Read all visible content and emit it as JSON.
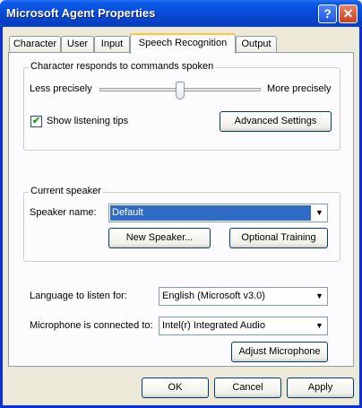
{
  "window": {
    "title": "Microsoft Agent Properties"
  },
  "titlebar_buttons": {
    "help": "?",
    "close": "✕"
  },
  "tabs": [
    {
      "label": "Character"
    },
    {
      "label": "User"
    },
    {
      "label": "Input"
    },
    {
      "label": "Speech Recognition",
      "active": true
    },
    {
      "label": "Output"
    }
  ],
  "commands_group": {
    "title": "Character responds to commands spoken",
    "less_label": "Less precisely",
    "more_label": "More precisely",
    "precision_level": 0.5,
    "show_tips_label": "Show listening tips",
    "show_tips_checked": true,
    "advanced_button": "Advanced Settings"
  },
  "speaker_group": {
    "title": "Current speaker",
    "speaker_label": "Speaker name:",
    "speaker_value": "Default",
    "new_speaker_button": "New Speaker...",
    "optional_training_button": "Optional Training"
  },
  "language": {
    "label": "Language to listen for:",
    "value": "English (Microsoft v3.0)"
  },
  "microphone": {
    "label": "Microphone is connected to:",
    "value": "Intel(r) Integrated Audio"
  },
  "adjust_microphone_button": "Adjust Microphone",
  "footer": {
    "ok": "OK",
    "cancel": "Cancel",
    "apply": "Apply"
  },
  "icons": {
    "checkmark": "✔",
    "dropdown": "▼"
  }
}
